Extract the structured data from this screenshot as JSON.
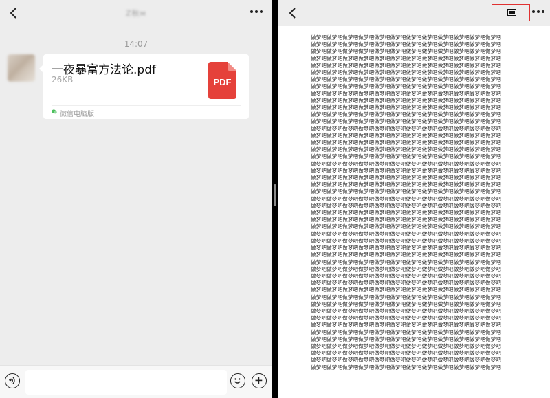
{
  "chat": {
    "title": "Z秋ᴍ",
    "timestamp": "14:07",
    "message": {
      "file_name": "一夜暴富方法论.pdf",
      "file_size": "26KB",
      "file_badge": "PDF",
      "source": "微信电脑版"
    },
    "input_placeholder": ""
  },
  "viewer": {
    "repeated_text": "做梦吧",
    "line_count": 48,
    "repeats_per_line": 12
  },
  "colors": {
    "pdf_red": "#e5413a",
    "highlight_red": "#e03131",
    "source_green": "#4bbf5c"
  },
  "icons": {
    "back": "chevron-left-icon",
    "more": "more-dots-icon",
    "window": "window-mode-icon",
    "voice": "voice-icon",
    "emoji": "emoji-icon",
    "plus": "plus-icon"
  }
}
